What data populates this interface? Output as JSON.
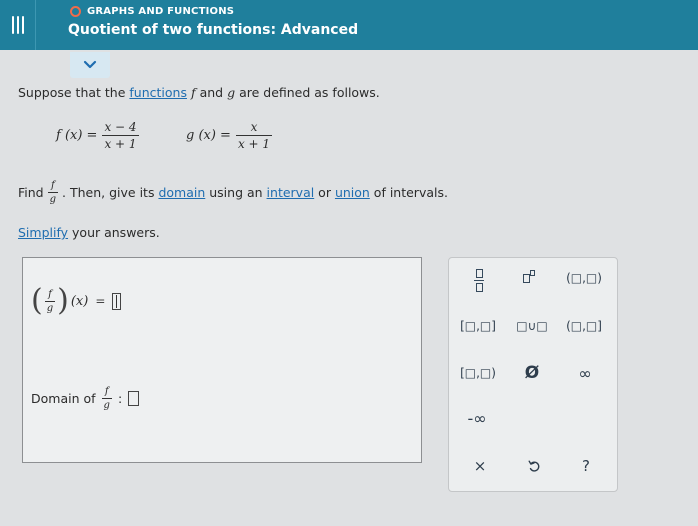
{
  "header": {
    "topic": "GRAPHS AND FUNCTIONS",
    "title": "Quotient of two functions: Advanced"
  },
  "problem": {
    "intro_prefix": "Suppose that the ",
    "intro_link": "functions",
    "intro_f": "f",
    "intro_and": " and ",
    "intro_g": "g",
    "intro_suffix": " are defined as follows.",
    "f_lhs": "f (x) =",
    "f_num": "x − 4",
    "f_den": "x + 1",
    "g_lhs": "g (x) =",
    "g_num": "x",
    "g_den": "x + 1",
    "find_label": "Find",
    "frac_f": "f",
    "frac_g": "g",
    "find_then": ". Then, give its ",
    "domain_link": "domain",
    "using_an": " using an ",
    "interval_link": "interval",
    "or_text": " or ",
    "union_link": "union",
    "of_intervals": " of intervals.",
    "simplify_link": "Simplify",
    "simplify_suffix": " your answers."
  },
  "answer": {
    "var_x": "(x)",
    "equals": "=",
    "domain_label": "Domain of",
    "colon": ":"
  },
  "keypad": {
    "interval_open_open": "(□,□)",
    "interval_closed_closed": "[□,□]",
    "union": "□∪□",
    "interval_open_closed": "(□,□]",
    "interval_closed_open": "[□,□)",
    "empty_set": "Ø",
    "infinity": "∞",
    "neg_infinity": "-∞",
    "clear": "×",
    "help": "?"
  }
}
